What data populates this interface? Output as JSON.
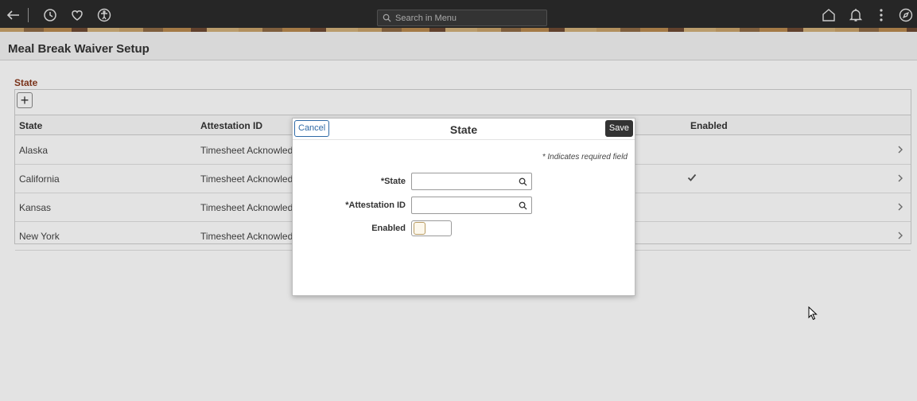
{
  "header": {
    "search_placeholder": "Search in Menu",
    "icons": [
      "back-arrow-icon",
      "history-icon",
      "favorites-icon",
      "accessibility-icon",
      "home-icon",
      "notifications-icon",
      "actions-menu-icon",
      "navbar-compass-icon"
    ]
  },
  "page": {
    "title": "Meal Break Waiver Setup"
  },
  "grid": {
    "caption": "State",
    "add_label": "+",
    "columns": [
      "State",
      "Attestation ID",
      "Enabled"
    ],
    "rows": [
      {
        "state": "Alaska",
        "attestation": "Timesheet Acknowledger",
        "enabled": false
      },
      {
        "state": "California",
        "attestation": "Timesheet Acknowledger",
        "enabled": true
      },
      {
        "state": "Kansas",
        "attestation": "Timesheet Acknowledger",
        "enabled": false
      },
      {
        "state": "New York",
        "attestation": "Timesheet Acknowledger",
        "enabled": false
      }
    ]
  },
  "modal": {
    "cancel_label": "Cancel",
    "title": "State",
    "save_label": "Save",
    "required_note": "* Indicates required field",
    "fields": {
      "state_label": "*State",
      "state_value": "",
      "attestation_label": "*Attestation ID",
      "attestation_value": "",
      "enabled_label": "Enabled",
      "enabled_value": false
    }
  },
  "colors": {
    "banner": "#2b2b2b",
    "caption": "#8a3a1e",
    "cancel_link": "#2f6aa6",
    "save_button": "#333333"
  }
}
